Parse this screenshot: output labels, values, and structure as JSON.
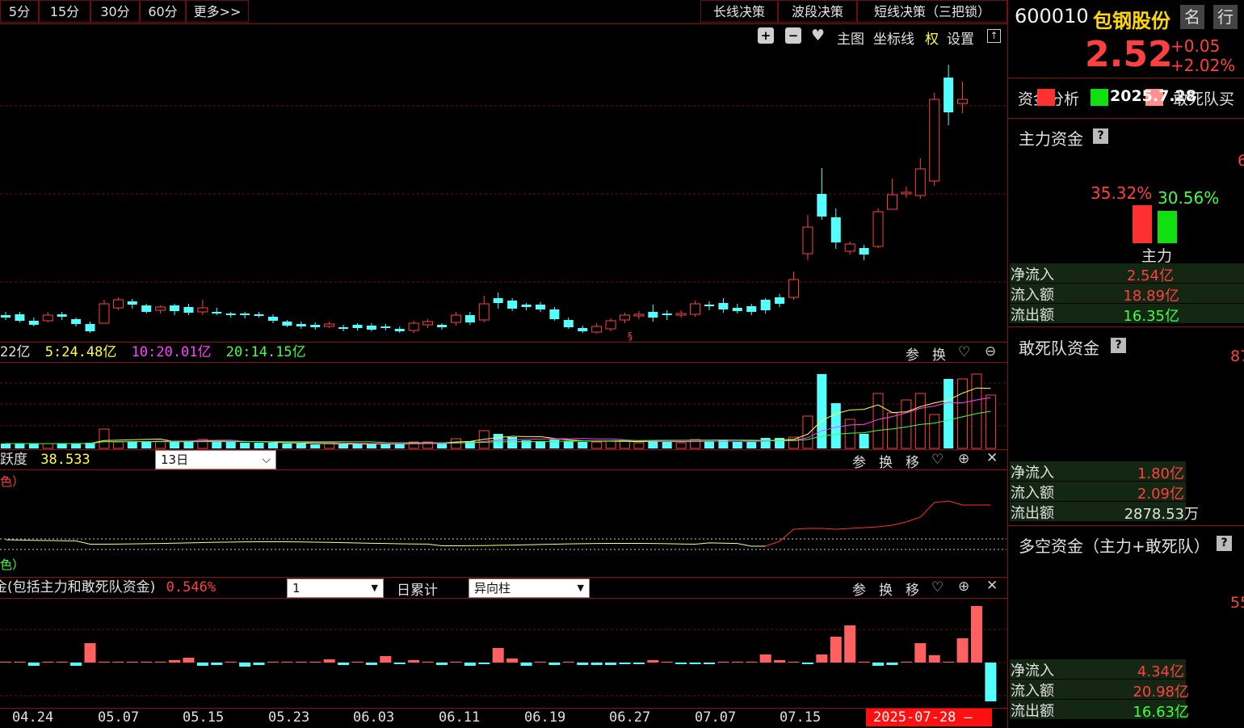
{
  "top_tabs": [
    "5分",
    "15分",
    "30分",
    "60分",
    "更多>>"
  ],
  "right_tabs": [
    "长线决策",
    "波段决策",
    "短线决策（三把锁）"
  ],
  "toolbar": {
    "main_chart": "主图",
    "coord_line": "坐标线",
    "rights": "权",
    "settings": "设置"
  },
  "stock": {
    "code": "600010",
    "name": "包钢股份",
    "price": "2.52",
    "change": "+0.05",
    "change_pct": "+2.02%",
    "btn_name": "名",
    "btn_row": "行"
  },
  "fund_tab_text": "资金分析",
  "date_badge": "2025.7.28",
  "tab_suffix": "敢死队买",
  "main_fund": {
    "title": "主力资金",
    "pct_red": "35.32%",
    "pct_green": "30.56%",
    "bar_label": "主力",
    "net_label": "净流入",
    "net": "2.54亿",
    "in_label": "流入额",
    "in": "18.89亿",
    "out_label": "流出额",
    "out": "16.35亿",
    "edge_num": "6"
  },
  "dare_fund": {
    "title": "敢死队资金",
    "net_label": "净流入",
    "net": "1.80亿",
    "in_label": "流入额",
    "in": "2.09亿",
    "out_label": "流出额",
    "out": "2878.53万",
    "edge_num": "87"
  },
  "long_short": {
    "title": "多空资金（主力+敢死队）",
    "net_label": "净流入",
    "net": "4.34亿",
    "in_label": "流入额",
    "in": "20.98亿",
    "out_label": "流出额",
    "out": "16.63亿",
    "edge_num": "55"
  },
  "volume_bar": {
    "prefix": "22亿",
    "ma5": "5:24.48亿",
    "ma10": "10:20.01亿",
    "ma20": "20:14.15亿",
    "icons": [
      "参",
      "换"
    ]
  },
  "activity_bar": {
    "prefix": "跃度",
    "value": "38.533",
    "period": "13日",
    "icons": [
      "参",
      "换",
      "移"
    ]
  },
  "activity_legend_top": "色）",
  "activity_legend_bottom": "色）",
  "fund_bar": {
    "prefix": "金(包括主力和敢死队资金)",
    "value": "0.546%",
    "select_value": "1",
    "mode": "日累计",
    "style": "异向柱",
    "icons": [
      "参",
      "换",
      "移"
    ]
  },
  "dates": [
    "04.24",
    "05.07",
    "05.15",
    "05.23",
    "06.03",
    "06.11",
    "06.19",
    "06.27",
    "07.07",
    "07.15"
  ],
  "current_date": "2025-07-28",
  "marker": "§",
  "colors": {
    "up": "#ff4040",
    "down": "#54ffff",
    "frame": "#8a1010",
    "yellow": "#ffff40",
    "magenta": "#ff40ff",
    "green": "#40ff40"
  }
}
